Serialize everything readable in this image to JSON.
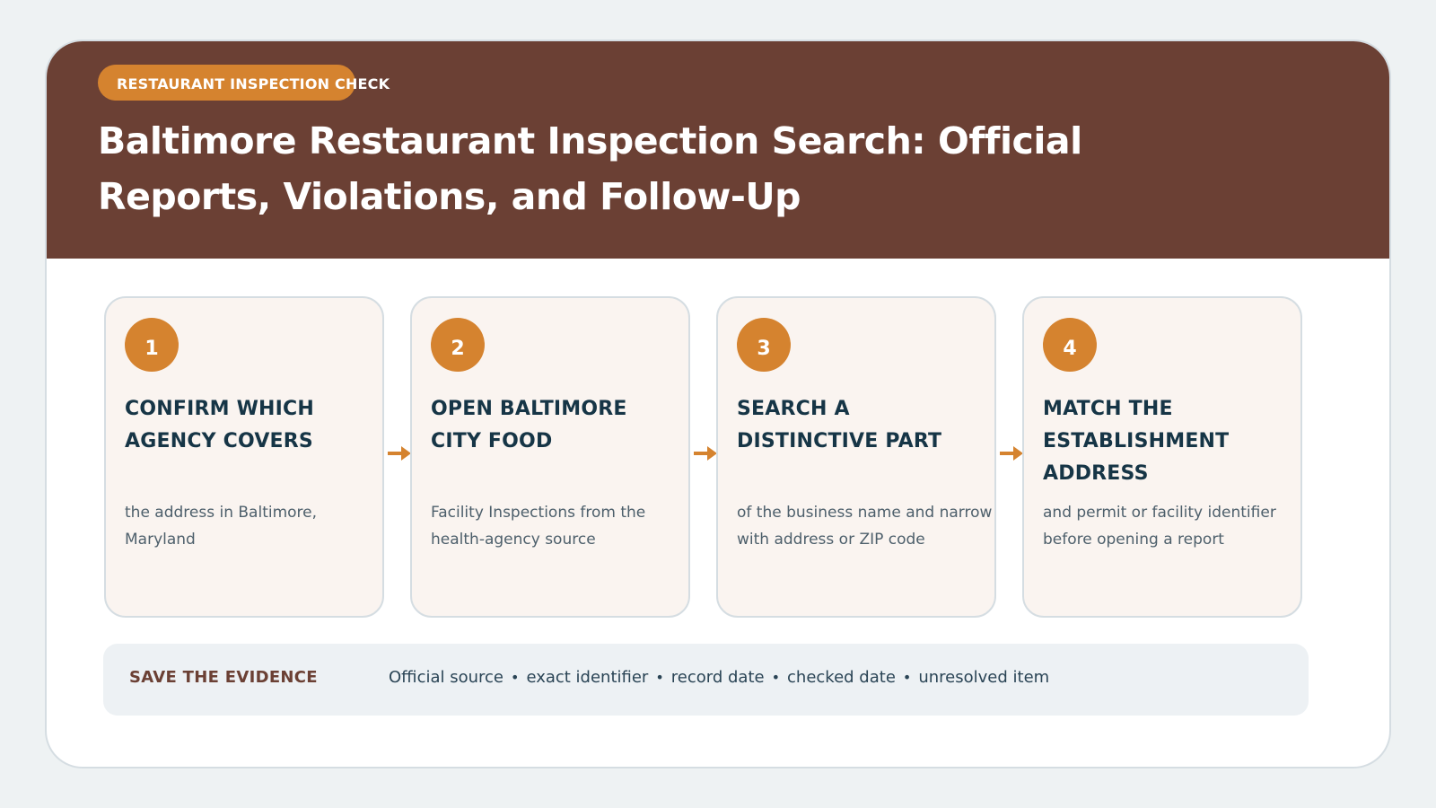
{
  "badge": "RESTAURANT INSPECTION CHECK",
  "title": "Baltimore Restaurant Inspection Search: Official Reports, Violations, and Follow-Up",
  "steps": [
    {
      "number": "1",
      "title": "CONFIRM WHICH AGENCY COVERS",
      "description": "the address in Baltimore, Maryland"
    },
    {
      "number": "2",
      "title": "OPEN BALTIMORE CITY FOOD",
      "description": "Facility Inspections from the health-agency source"
    },
    {
      "number": "3",
      "title": "SEARCH A DISTINCTIVE PART",
      "description": "of the business name and narrow with address or ZIP code"
    },
    {
      "number": "4",
      "title": "MATCH THE ESTABLISHMENT ADDRESS",
      "description": "and permit or facility identifier before opening a report"
    }
  ],
  "evidence": {
    "label": "SAVE THE EVIDENCE",
    "items": [
      "Official source",
      "exact identifier",
      "record date",
      "checked date",
      "unresolved item"
    ],
    "separator": "•"
  },
  "colors": {
    "header": "#6b4034",
    "accent": "#d5832f",
    "step_title": "#163546",
    "background": "#eef2f3"
  }
}
